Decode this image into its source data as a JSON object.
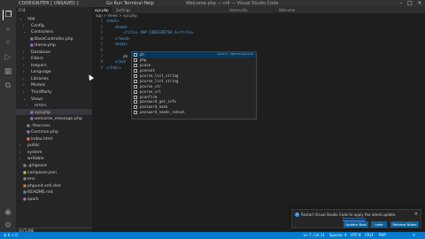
{
  "colors": {
    "accent": "#007acc",
    "selection": "#04395e",
    "tag": "#569cd6"
  },
  "titlebar": {
    "left": "CODEIGNITER  [ UNSAVED ]",
    "menu": "Go  Run  Terminal  Help",
    "center": "Welcome.php — ci4 — Visual Studio Code"
  },
  "activity_icons": [
    "files-icon",
    "search-icon",
    "source-control-icon",
    "run-debug-icon",
    "extensions-icon",
    "remote-icon",
    "account-icon",
    "settings-icon"
  ],
  "sidebar": {
    "title": "CI4",
    "items": [
      {
        "label": "app",
        "indent": 1,
        "chevron": "v",
        "kind": "folder"
      },
      {
        "label": "Config",
        "indent": 2,
        "chevron": ">",
        "kind": "folder"
      },
      {
        "label": "Controllers",
        "indent": 2,
        "chevron": "v",
        "kind": "folder"
      },
      {
        "label": "BaseController.php",
        "indent": 3,
        "chevron": "",
        "kind": "php"
      },
      {
        "label": "Home.php",
        "indent": 3,
        "chevron": "",
        "kind": "php"
      },
      {
        "label": "Database",
        "indent": 2,
        "chevron": ">",
        "kind": "folder"
      },
      {
        "label": "Filters",
        "indent": 2,
        "chevron": ">",
        "kind": "folder"
      },
      {
        "label": "Helpers",
        "indent": 2,
        "chevron": ">",
        "kind": "folder"
      },
      {
        "label": "Language",
        "indent": 2,
        "chevron": ">",
        "kind": "folder"
      },
      {
        "label": "Libraries",
        "indent": 2,
        "chevron": ">",
        "kind": "folder"
      },
      {
        "label": "Models",
        "indent": 2,
        "chevron": ">",
        "kind": "folder"
      },
      {
        "label": "ThirdParty",
        "indent": 2,
        "chevron": ">",
        "kind": "folder"
      },
      {
        "label": "Views",
        "indent": 2,
        "chevron": "v",
        "kind": "folder"
      },
      {
        "label": "errors",
        "indent": 3,
        "chevron": ">",
        "kind": "folder"
      },
      {
        "label": "xyz.php",
        "indent": 3,
        "chevron": "",
        "kind": "php"
      },
      {
        "label": "welcome_message.php",
        "indent": 3,
        "chevron": "",
        "kind": "php"
      },
      {
        "label": ".htaccess",
        "indent": 2,
        "chevron": "",
        "kind": "file"
      },
      {
        "label": "Common.php",
        "indent": 2,
        "chevron": "",
        "kind": "php"
      },
      {
        "label": "index.html",
        "indent": 2,
        "chevron": "",
        "kind": "html"
      },
      {
        "label": "public",
        "indent": 1,
        "chevron": ">",
        "kind": "folder"
      },
      {
        "label": "system",
        "indent": 1,
        "chevron": ">",
        "kind": "folder"
      },
      {
        "label": "writable",
        "indent": 1,
        "chevron": ">",
        "kind": "folder"
      },
      {
        "label": ".gitignore",
        "indent": 1,
        "chevron": "",
        "kind": "file"
      },
      {
        "label": "composer.json",
        "indent": 1,
        "chevron": "",
        "kind": "json"
      },
      {
        "label": "env",
        "indent": 1,
        "chevron": "",
        "kind": "file"
      },
      {
        "label": "phpunit.xml.dist",
        "indent": 1,
        "chevron": "",
        "kind": "xml"
      },
      {
        "label": "README.md",
        "indent": 1,
        "chevron": "",
        "kind": "md"
      },
      {
        "label": "spark",
        "indent": 1,
        "chevron": "",
        "kind": "file"
      }
    ],
    "selected_index": 14,
    "outline_label": "OUTLINE"
  },
  "editor": {
    "tabs": [
      {
        "label": "xyz.php",
        "active": true
      },
      {
        "label": "Settings",
        "active": false
      },
      {
        "label": "Home.php",
        "active": false
      },
      {
        "label": "Welcome",
        "active": false
      }
    ],
    "breadcrumb": "app > Views > xyz.php",
    "lines": [
      {
        "n": "1",
        "text": "<html>",
        "kind": "tag"
      },
      {
        "n": "2",
        "text": "    <head>",
        "kind": "tag"
      },
      {
        "n": "3",
        "text": "        <title> PHP CODEIGNITER 4</title>",
        "kind": "mixed"
      },
      {
        "n": "4",
        "text": "    </head>",
        "kind": "tag"
      },
      {
        "n": "5",
        "text": "    <body>",
        "kind": "tag"
      },
      {
        "n": "6",
        "text": "",
        "kind": "tag"
      },
      {
        "n": "7",
        "text": "        ph",
        "kind": "text"
      },
      {
        "n": "8",
        "text": "    </bod",
        "kind": "tag"
      },
      {
        "n": "9",
        "text": "</html>",
        "kind": "tag"
      }
    ]
  },
  "suggest": {
    "detail": "Insert Abbreviation",
    "items": [
      "ph",
      "php",
      "pcase",
      "pconset",
      "pcurse_list_string",
      "pcurse_list_string",
      "pcurse_str",
      "pcurse_url",
      "pconfirm",
      "password_get_info",
      "password_hash",
      "password_needs_rehash"
    ]
  },
  "notification": {
    "message": "Restart Visual Studio Code to apply the latest update.",
    "link": "Release Notes",
    "buttons": [
      "Update Now",
      "Later",
      "Release Notes"
    ]
  },
  "statusbar": {
    "left": "⊗ 0 ⚠ 0",
    "right": [
      "Ln 7, Col 11",
      "Spaces: 4",
      "UTF-8",
      "CRLF",
      "PHP",
      "⚲"
    ]
  }
}
